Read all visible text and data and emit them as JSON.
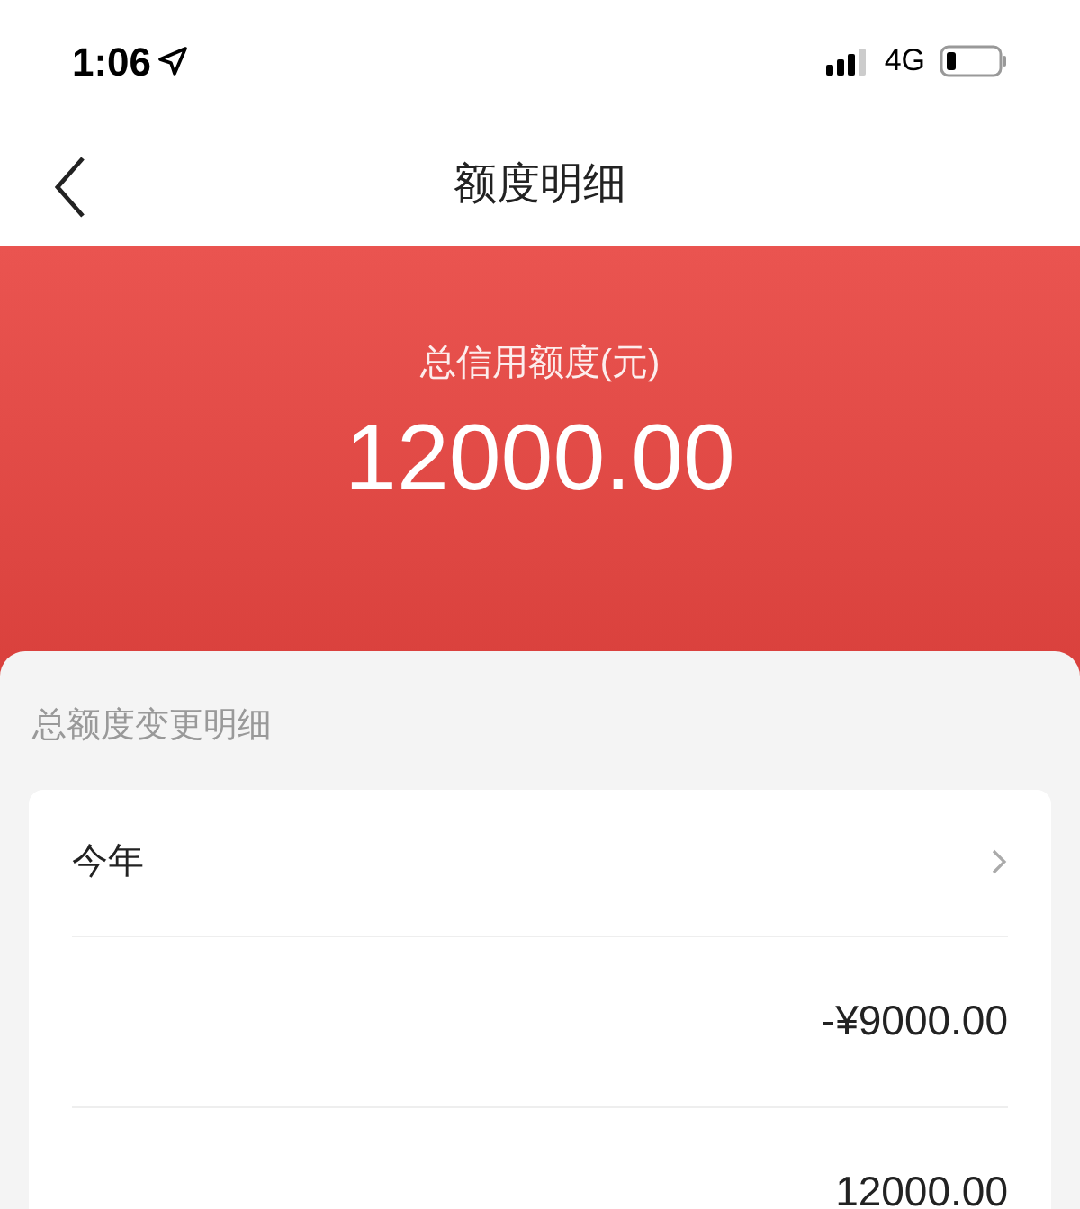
{
  "status_bar": {
    "time": "1:06",
    "network": "4G"
  },
  "nav": {
    "title": "额度明细"
  },
  "summary": {
    "label": "总信用额度(元)",
    "amount": "12000.00"
  },
  "section": {
    "title": "总额度变更明细"
  },
  "group": {
    "title": "今年",
    "expanded": true
  },
  "records": [
    {
      "amount": "-¥9000.00"
    },
    {
      "amount": "12000.00"
    }
  ]
}
